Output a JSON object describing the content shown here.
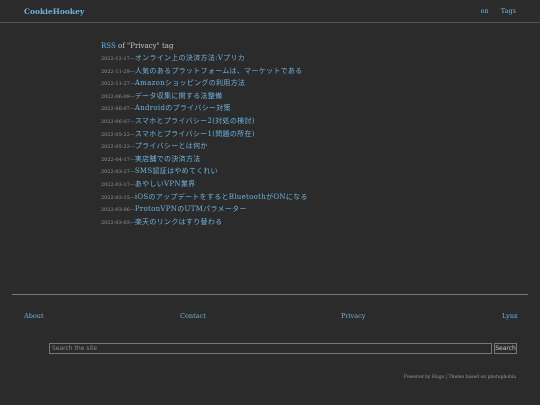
{
  "header": {
    "brand": "CookieHookey",
    "lang": "en",
    "tags": "Tags"
  },
  "tag_page": {
    "rss": "RSS",
    "of": " of ",
    "tag_label": "\"Privacy\" tag"
  },
  "posts": [
    {
      "date": "2022-12-17",
      "title": "オンライン上の決済方法:Vプリカ"
    },
    {
      "date": "2022-11-29",
      "title": "人気のあるプラットフォームは、マーケットである"
    },
    {
      "date": "2022-11-27",
      "title": "Amazonショッピングの利用方法"
    },
    {
      "date": "2022-06-09",
      "title": "データ収集に関する法整備"
    },
    {
      "date": "2022-06-07",
      "title": "Androidのプライバシー対策"
    },
    {
      "date": "2022-06-07",
      "title": "スマホとプライバシー2(対処の検討)"
    },
    {
      "date": "2022-05-22",
      "title": "スマホとプライバシー1(問題の所在)"
    },
    {
      "date": "2022-05-22",
      "title": "プライバシーとは何か"
    },
    {
      "date": "2022-04-17",
      "title": "実店舗での決済方法"
    },
    {
      "date": "2022-03-27",
      "title": "SMS認証はやめてくれい"
    },
    {
      "date": "2022-03-17",
      "title": "あやしいVPN業界"
    },
    {
      "date": "2022-03-15",
      "title": "iOSのアップデートをするとBluetoothがONになる"
    },
    {
      "date": "2022-03-06",
      "title": "ProtonVPNのUTMパラメーター"
    },
    {
      "date": "2022-03-03",
      "title": "楽天のリンクはすり替わる"
    }
  ],
  "date_separator": "—",
  "footer": {
    "links": [
      "About",
      "Contact",
      "Privacy",
      "Lynx"
    ],
    "search_placeholder": "Search the site",
    "search_button": "Search",
    "credit": "Powered by Hugo | Theme based on photophobia"
  }
}
